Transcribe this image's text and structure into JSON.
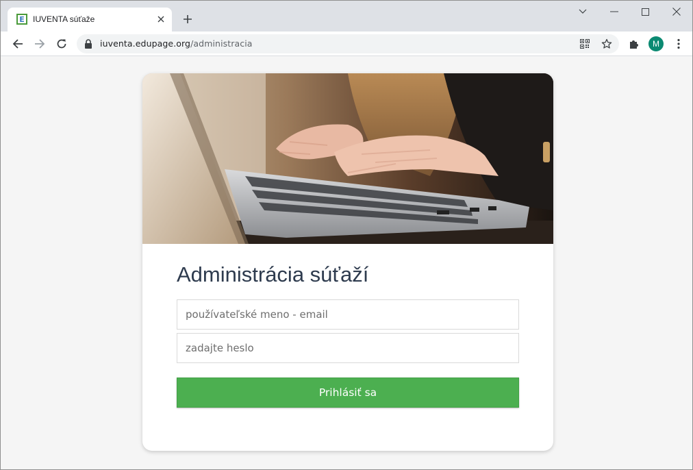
{
  "browser": {
    "tab_title": "IUVENTA súťaže",
    "favicon_letter": "E",
    "url_host": "iuventa.edupage.org",
    "url_path": "/administracia",
    "profile_initial": "M"
  },
  "login": {
    "title": "Administrácia súťaží",
    "username_placeholder": "používateľské meno - email",
    "password_placeholder": "zadajte heslo",
    "submit_label": "Prihlásiť sa"
  },
  "colors": {
    "accent_green": "#4caf50",
    "title_color": "#2e3b4e",
    "avatar_bg": "#0b8a72"
  },
  "icons": [
    "back-icon",
    "forward-icon",
    "reload-icon",
    "lock-icon",
    "qr-code-icon",
    "star-icon",
    "extensions-icon",
    "menu-icon",
    "close-icon",
    "plus-icon",
    "chevron-down-icon",
    "minimize-icon",
    "maximize-icon"
  ]
}
